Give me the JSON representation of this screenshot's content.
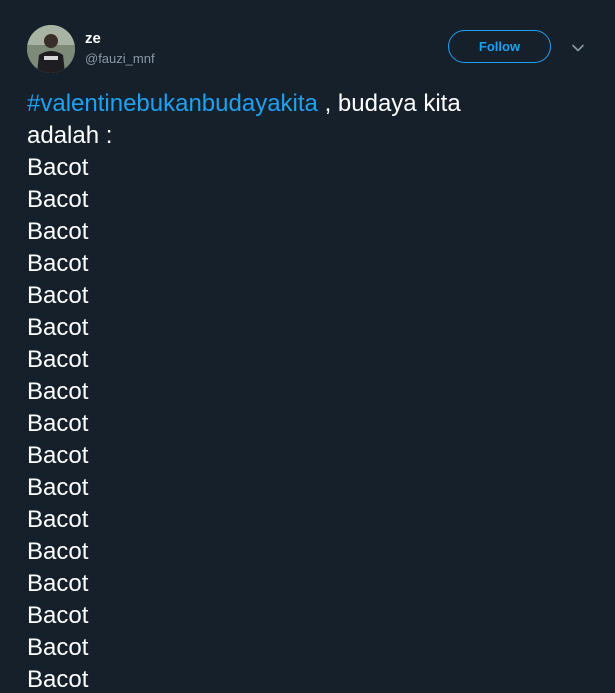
{
  "user": {
    "display_name": "ze",
    "handle": "@fauzi_mnf"
  },
  "actions": {
    "follow_label": "Follow",
    "menu_icon": "chevron-down-icon"
  },
  "tweet": {
    "hashtag": "#valentinebukanbudayakita",
    "intro_rest": " , budaya kita",
    "line2": "adalah :",
    "repeated_lines": [
      "Bacot",
      "Bacot",
      "Bacot",
      "Bacot",
      "Bacot",
      "Bacot",
      "Bacot",
      "Bacot",
      "Bacot",
      "Bacot",
      "Bacot",
      "Bacot",
      "Bacot",
      "Bacot",
      "Bacot",
      "Bacot",
      "Bacot"
    ]
  },
  "colors": {
    "background": "#15202b",
    "accent": "#1da1f2",
    "secondary_text": "#8899a6"
  }
}
